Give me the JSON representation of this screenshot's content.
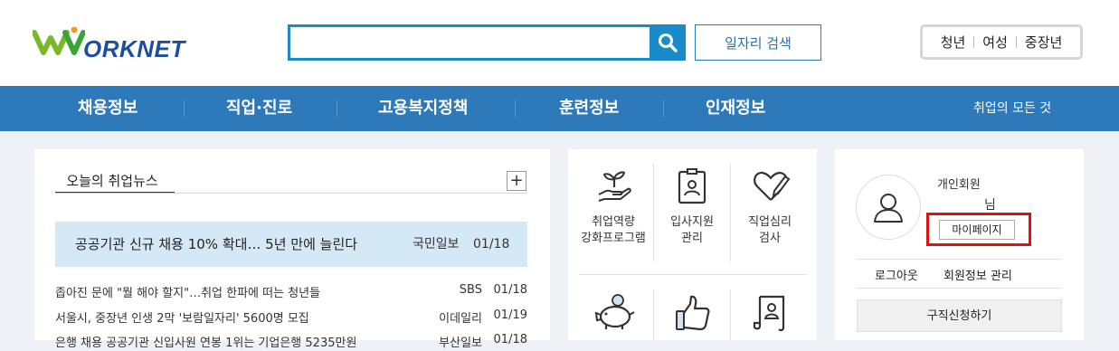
{
  "header": {
    "logo_text": "ORKNET",
    "search": {
      "placeholder": "",
      "value": ""
    },
    "job_search_label": "일자리 검색",
    "groups": [
      "청년",
      "여성",
      "중장년"
    ]
  },
  "nav": {
    "items": [
      "채용정보",
      "직업·진로",
      "고용복지정책",
      "훈련정보",
      "인재정보"
    ],
    "all_label": "취업의 모든 것"
  },
  "news": {
    "tab_label": "오늘의 취업뉴스",
    "more_label": "+",
    "headline": {
      "title": "공공기관 신규 채용 10% 확대… 5년 만에 늘린다",
      "source": "국민일보",
      "date": "01/18"
    },
    "items": [
      {
        "title": "좁아진 문에 \"뭘 해야 할지\"…취업 한파에 떠는 청년들",
        "source": "SBS",
        "date": "01/18"
      },
      {
        "title": "서울시, 중장년 인생 2막 '보람일자리' 5600명 모집",
        "source": "이데일리",
        "date": "01/19"
      },
      {
        "title": "은행 채용 공공기관 신입사원 연봉 1위는 기업은행 5235만원",
        "source": "부산일보",
        "date": "01/18"
      }
    ]
  },
  "services": {
    "row1": [
      {
        "icon": "sprout-hand-icon",
        "label_1": "취업역량",
        "label_2": "강화프로그램"
      },
      {
        "icon": "id-card-icon",
        "label_1": "입사지원",
        "label_2": "관리"
      },
      {
        "icon": "heart-pen-icon",
        "label_1": "직업심리",
        "label_2": "검사"
      }
    ],
    "row2": [
      {
        "icon": "piggy-bank-icon"
      },
      {
        "icon": "thumbs-up-icon"
      },
      {
        "icon": "scroll-profile-icon"
      }
    ]
  },
  "member": {
    "type": "개인회원",
    "honorific": "님",
    "mypage_label": "마이페이지",
    "logout_label": "로그아웃",
    "info_label": "회원정보 관리",
    "apply_label": "구직신청하기"
  },
  "colors": {
    "brand_blue": "#2e79b9",
    "search_blue": "#1a8bc9",
    "headline_bg": "#d5e8f6",
    "highlight_red": "#e01010",
    "logo_green": "#7ab829",
    "logo_orange": "#f39a1e"
  }
}
